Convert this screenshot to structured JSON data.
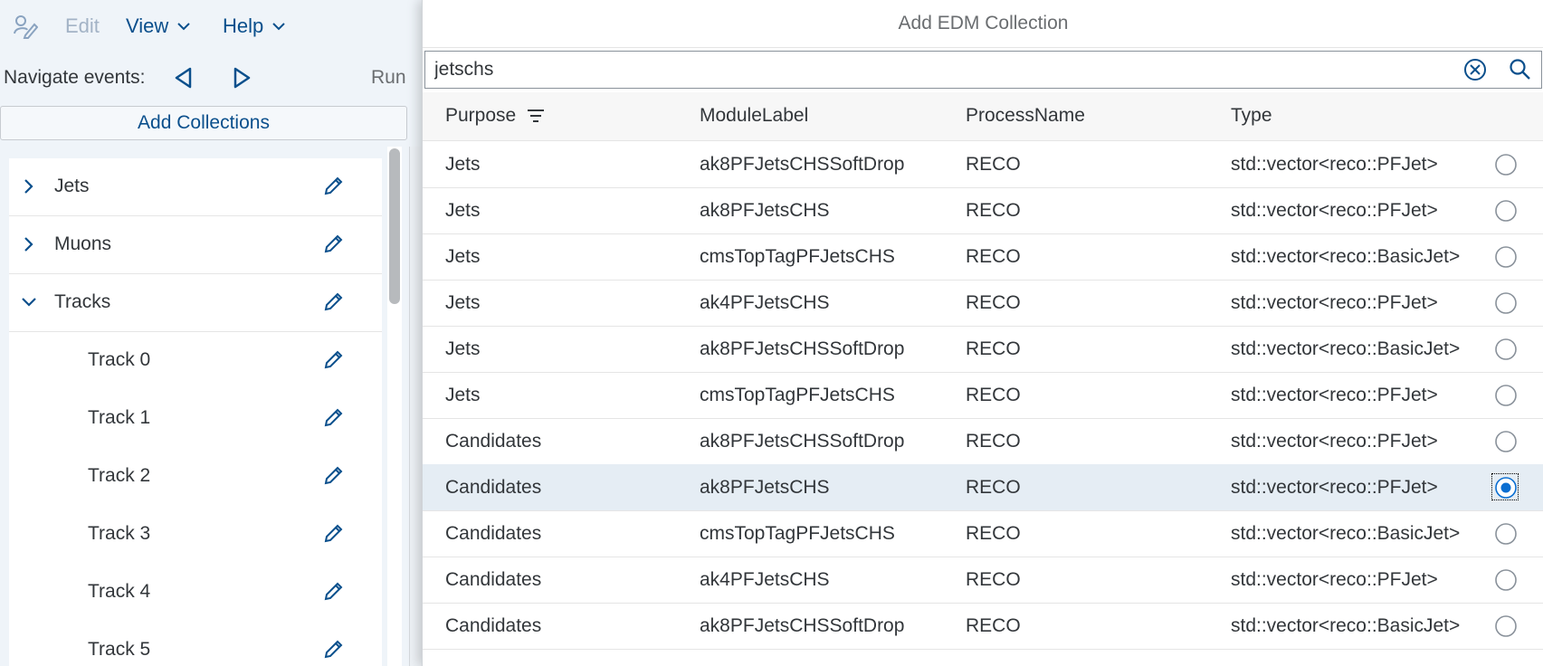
{
  "menubar": {
    "edit_label": "Edit",
    "view_label": "View",
    "help_label": "Help",
    "icons": {
      "edit": "pencil-person-icon",
      "chevron": "chevron-down-icon"
    }
  },
  "navbar": {
    "label": "Navigate events:",
    "prev_icon": "triangle-left-icon",
    "next_icon": "triangle-right-icon",
    "run_label": "Run"
  },
  "sidebar": {
    "add_button_label": "Add Collections",
    "tree": [
      {
        "label": "Jets",
        "expanded": false
      },
      {
        "label": "Muons",
        "expanded": false
      },
      {
        "label": "Tracks",
        "expanded": true
      }
    ],
    "children": [
      "Track 0",
      "Track 1",
      "Track 2",
      "Track 3",
      "Track 4",
      "Track 5"
    ]
  },
  "dialog": {
    "title": "Add EDM Collection",
    "search": {
      "value": "jetschs",
      "placeholder": ""
    },
    "columns": {
      "purpose": "Purpose",
      "module": "ModuleLabel",
      "process": "ProcessName",
      "type": "Type"
    },
    "rows": [
      {
        "purpose": "Jets",
        "module": "ak8PFJetsCHSSoftDrop",
        "process": "RECO",
        "type": "std::vector<reco::PFJet>",
        "selected": false
      },
      {
        "purpose": "Jets",
        "module": "ak8PFJetsCHS",
        "process": "RECO",
        "type": "std::vector<reco::PFJet>",
        "selected": false
      },
      {
        "purpose": "Jets",
        "module": "cmsTopTagPFJetsCHS",
        "process": "RECO",
        "type": "std::vector<reco::BasicJet>",
        "selected": false
      },
      {
        "purpose": "Jets",
        "module": "ak4PFJetsCHS",
        "process": "RECO",
        "type": "std::vector<reco::PFJet>",
        "selected": false
      },
      {
        "purpose": "Jets",
        "module": "ak8PFJetsCHSSoftDrop",
        "process": "RECO",
        "type": "std::vector<reco::BasicJet>",
        "selected": false
      },
      {
        "purpose": "Jets",
        "module": "cmsTopTagPFJetsCHS",
        "process": "RECO",
        "type": "std::vector<reco::PFJet>",
        "selected": false
      },
      {
        "purpose": "Candidates",
        "module": "ak8PFJetsCHSSoftDrop",
        "process": "RECO",
        "type": "std::vector<reco::PFJet>",
        "selected": false
      },
      {
        "purpose": "Candidates",
        "module": "ak8PFJetsCHS",
        "process": "RECO",
        "type": "std::vector<reco::PFJet>",
        "selected": true
      },
      {
        "purpose": "Candidates",
        "module": "cmsTopTagPFJetsCHS",
        "process": "RECO",
        "type": "std::vector<reco::BasicJet>",
        "selected": false
      },
      {
        "purpose": "Candidates",
        "module": "ak4PFJetsCHS",
        "process": "RECO",
        "type": "std::vector<reco::PFJet>",
        "selected": false
      },
      {
        "purpose": "Candidates",
        "module": "ak8PFJetsCHSSoftDrop",
        "process": "RECO",
        "type": "std::vector<reco::BasicJet>",
        "selected": false
      }
    ]
  },
  "colors": {
    "accent": "#0a4f8c",
    "selected_row": "#e5edf4",
    "app_background": "#eff4f9"
  }
}
